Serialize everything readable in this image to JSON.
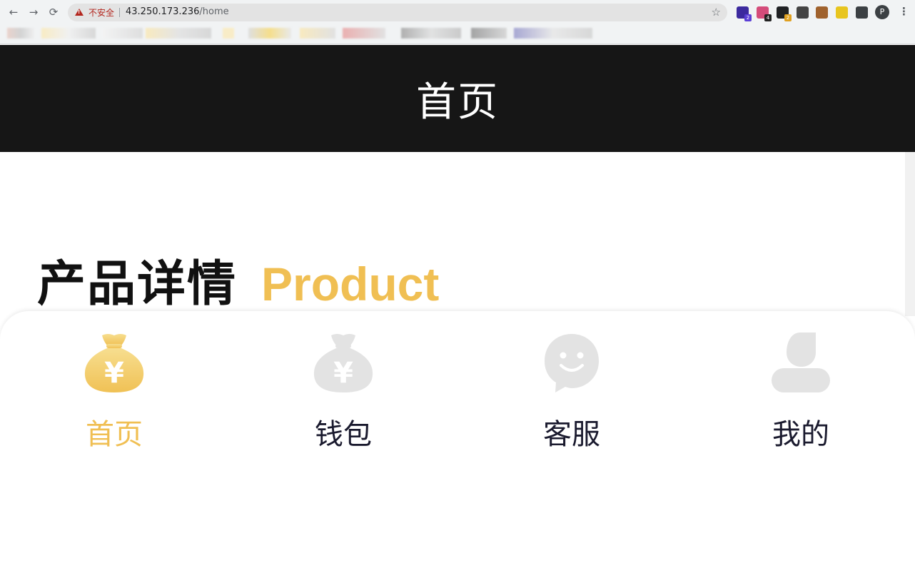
{
  "browser": {
    "insecure_label": "不安全",
    "url_host": "43.250.173.236",
    "url_path": "/home",
    "profile_initial": "P",
    "extensions": [
      {
        "name": "ext-1",
        "color": "#3c2a9e",
        "badge": "2",
        "badge_color": "#5b3fd6"
      },
      {
        "name": "ext-2",
        "color": "#d44c7a",
        "badge": "4",
        "badge_color": "#222222"
      },
      {
        "name": "ext-3",
        "color": "#202124",
        "badge": "2",
        "badge_color": "#e0a020"
      },
      {
        "name": "ext-4",
        "color": "#444444",
        "badge": "",
        "badge_color": ""
      },
      {
        "name": "ext-5",
        "color": "#a0622d",
        "badge": "",
        "badge_color": ""
      },
      {
        "name": "ext-6",
        "color": "#e8c51e",
        "badge": "",
        "badge_color": ""
      },
      {
        "name": "ext-7",
        "color": "#3c4043",
        "badge": "",
        "badge_color": ""
      }
    ]
  },
  "header": {
    "title": "首页"
  },
  "section": {
    "title_cn": "产品详情",
    "title_en": "Product"
  },
  "tabbar": {
    "accent": "#f0bf53",
    "inactive_icon": "#e3e3e3",
    "tabs": [
      {
        "label": "首页",
        "icon": "money-bag-icon",
        "active": true
      },
      {
        "label": "钱包",
        "icon": "money-bag-icon",
        "active": false
      },
      {
        "label": "客服",
        "icon": "chat-smile-icon",
        "active": false
      },
      {
        "label": "我的",
        "icon": "user-icon",
        "active": false
      }
    ]
  }
}
